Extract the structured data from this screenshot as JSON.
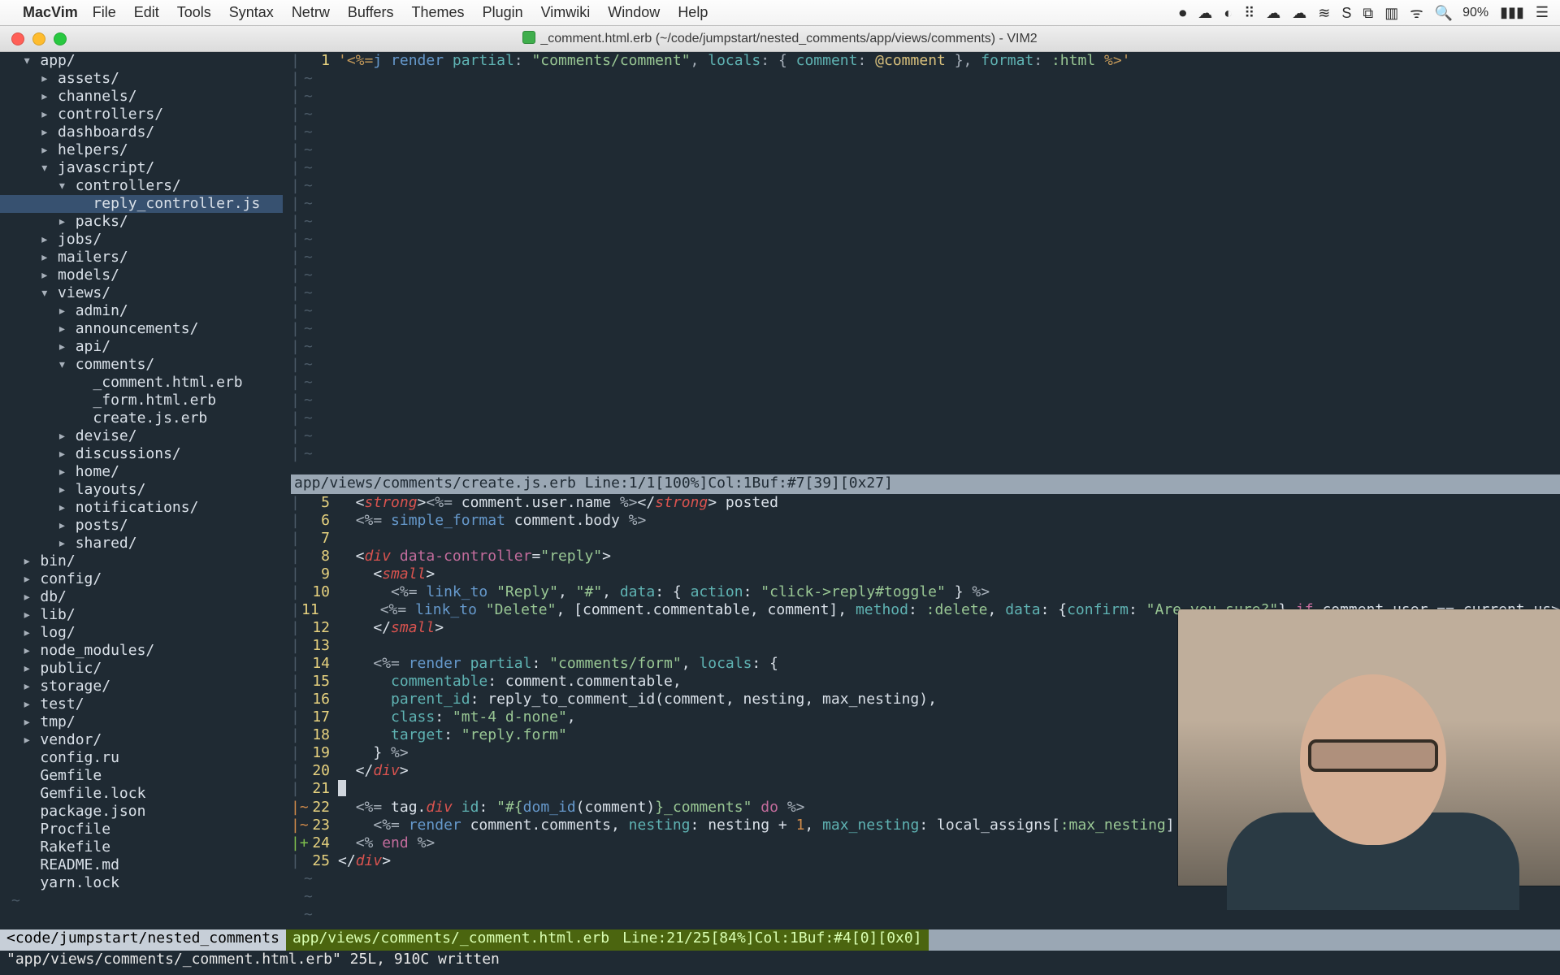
{
  "menubar": {
    "apple": "",
    "app": "MacVim",
    "items": [
      "File",
      "Edit",
      "Tools",
      "Syntax",
      "Netrw",
      "Buffers",
      "Themes",
      "Plugin",
      "Vimwiki",
      "Window",
      "Help"
    ],
    "right_icons": [
      "⏺",
      "☁",
      "◐",
      "⠿",
      "☁",
      "☁",
      "≋",
      "S",
      "⧉",
      "▥",
      "ᯤ",
      "🔍"
    ],
    "percent": "90%",
    "battery": "▮▮▮",
    "hamburger": "☰"
  },
  "titlebar": {
    "title": "_comment.html.erb (~/code/jumpstart/nested_comments/app/views/comments) - VIM2"
  },
  "tree": [
    {
      "i": 0,
      "a": "▾",
      "t": "app/",
      "folder": true
    },
    {
      "i": 1,
      "a": "▸",
      "t": "assets/",
      "folder": true
    },
    {
      "i": 1,
      "a": "▸",
      "t": "channels/",
      "folder": true
    },
    {
      "i": 1,
      "a": "▸",
      "t": "controllers/",
      "folder": true
    },
    {
      "i": 1,
      "a": "▸",
      "t": "dashboards/",
      "folder": true
    },
    {
      "i": 1,
      "a": "▸",
      "t": "helpers/",
      "folder": true
    },
    {
      "i": 1,
      "a": "▾",
      "t": "javascript/",
      "folder": true
    },
    {
      "i": 2,
      "a": "▾",
      "t": "controllers/",
      "folder": true
    },
    {
      "i": 3,
      "a": "",
      "t": "reply_controller.js",
      "folder": false,
      "sel": true
    },
    {
      "i": 2,
      "a": "▸",
      "t": "packs/",
      "folder": true
    },
    {
      "i": 1,
      "a": "▸",
      "t": "jobs/",
      "folder": true
    },
    {
      "i": 1,
      "a": "▸",
      "t": "mailers/",
      "folder": true
    },
    {
      "i": 1,
      "a": "▸",
      "t": "models/",
      "folder": true
    },
    {
      "i": 1,
      "a": "▾",
      "t": "views/",
      "folder": true
    },
    {
      "i": 2,
      "a": "▸",
      "t": "admin/",
      "folder": true
    },
    {
      "i": 2,
      "a": "▸",
      "t": "announcements/",
      "folder": true
    },
    {
      "i": 2,
      "a": "▸",
      "t": "api/",
      "folder": true
    },
    {
      "i": 2,
      "a": "▾",
      "t": "comments/",
      "folder": true
    },
    {
      "i": 3,
      "a": "",
      "t": "_comment.html.erb",
      "folder": false
    },
    {
      "i": 3,
      "a": "",
      "t": "_form.html.erb",
      "folder": false
    },
    {
      "i": 3,
      "a": "",
      "t": "create.js.erb",
      "folder": false
    },
    {
      "i": 2,
      "a": "▸",
      "t": "devise/",
      "folder": true
    },
    {
      "i": 2,
      "a": "▸",
      "t": "discussions/",
      "folder": true
    },
    {
      "i": 2,
      "a": "▸",
      "t": "home/",
      "folder": true
    },
    {
      "i": 2,
      "a": "▸",
      "t": "layouts/",
      "folder": true
    },
    {
      "i": 2,
      "a": "▸",
      "t": "notifications/",
      "folder": true
    },
    {
      "i": 2,
      "a": "▸",
      "t": "posts/",
      "folder": true
    },
    {
      "i": 2,
      "a": "▸",
      "t": "shared/",
      "folder": true
    },
    {
      "i": 0,
      "a": "▸",
      "t": "bin/",
      "folder": true
    },
    {
      "i": 0,
      "a": "▸",
      "t": "config/",
      "folder": true
    },
    {
      "i": 0,
      "a": "▸",
      "t": "db/",
      "folder": true
    },
    {
      "i": 0,
      "a": "▸",
      "t": "lib/",
      "folder": true
    },
    {
      "i": 0,
      "a": "▸",
      "t": "log/",
      "folder": true
    },
    {
      "i": 0,
      "a": "▸",
      "t": "node_modules/",
      "folder": true
    },
    {
      "i": 0,
      "a": "▸",
      "t": "public/",
      "folder": true
    },
    {
      "i": 0,
      "a": "▸",
      "t": "storage/",
      "folder": true
    },
    {
      "i": 0,
      "a": "▸",
      "t": "test/",
      "folder": true
    },
    {
      "i": 0,
      "a": "▸",
      "t": "tmp/",
      "folder": true
    },
    {
      "i": 0,
      "a": "▸",
      "t": "vendor/",
      "folder": true
    },
    {
      "i": 0,
      "a": "",
      "t": "config.ru",
      "folder": false
    },
    {
      "i": 0,
      "a": "",
      "t": "Gemfile",
      "folder": false
    },
    {
      "i": 0,
      "a": "",
      "t": "Gemfile.lock",
      "folder": false
    },
    {
      "i": 0,
      "a": "",
      "t": "package.json",
      "folder": false
    },
    {
      "i": 0,
      "a": "",
      "t": "Procfile",
      "folder": false
    },
    {
      "i": 0,
      "a": "",
      "t": "Rakefile",
      "folder": false
    },
    {
      "i": 0,
      "a": "",
      "t": "README.md",
      "folder": false
    },
    {
      "i": 0,
      "a": "",
      "t": "yarn.lock",
      "folder": false
    }
  ],
  "top_pane": {
    "line_no": "1",
    "code_html": "<span class='c-str'>'&lt;%=</span><span class='c-fn'>j</span> <span class='c-fn'>render</span> <span class='c-id'>partial</span><span class='c-pun'>:</span> <span class='c-sym'>\"comments/comment\"</span><span class='c-pun'>,</span> <span class='c-id'>locals</span><span class='c-pun'>: {</span> <span class='c-id'>comment</span><span class='c-pun'>:</span> <span class='c-var'>@comment</span> <span class='c-pun'>},</span> <span class='c-id'>format</span><span class='c-pun'>:</span> <span class='c-sym'>:html</span> <span class='c-str'>%&gt;'</span>"
  },
  "splitbar": "app/views/comments/create.js.erb   Line:1/1[100%]Col:1Buf:#7[39][0x27]",
  "bottom_pane": {
    "rows": [
      {
        "no": "5",
        "g": " ",
        "html": "  &lt;<span class='c-red'>strong</span>&gt;<span class='c-pun'>&lt;%=</span> comment.user.name <span class='c-pun'>%&gt;</span>&lt;/<span class='c-red'>strong</span>&gt; posted"
      },
      {
        "no": "6",
        "g": " ",
        "html": "  <span class='c-pun'>&lt;%=</span> <span class='c-fn'>simple_format</span> comment.body <span class='c-pun'>%&gt;</span>"
      },
      {
        "no": "7",
        "g": " ",
        "html": ""
      },
      {
        "no": "8",
        "g": " ",
        "html": "  &lt;<span class='c-red'>div</span> <span class='c-attr'>data-controller</span>=<span class='c-sym'>\"reply\"</span>&gt;"
      },
      {
        "no": "9",
        "g": " ",
        "html": "    &lt;<span class='c-red'>small</span>&gt;"
      },
      {
        "no": "10",
        "g": " ",
        "html": "      <span class='c-pun'>&lt;%=</span> <span class='c-fn'>link_to</span> <span class='c-sym'>\"Reply\"</span>, <span class='c-sym'>\"#\"</span>, <span class='c-id'>data</span>: { <span class='c-id'>action</span>: <span class='c-sym'>\"click-&gt;reply#toggle\"</span> } <span class='c-pun'>%&gt;</span>"
      },
      {
        "no": "11",
        "g": " ",
        "html": "      <span class='c-pun'>&lt;%=</span> <span class='c-fn'>link_to</span> <span class='c-sym'>\"Delete\"</span>, [comment.commentable, comment], <span class='c-id'>method</span>: <span class='c-sym'>:delete</span>, <span class='c-id'>data</span>: {<span class='c-id'>confirm</span>: <span class='c-sym'>\"Are you sure?\"</span>} <span class='c-key'>if</span> comment.user == current_us&gt;"
      },
      {
        "no": "12",
        "g": " ",
        "html": "    &lt;/<span class='c-red'>small</span>&gt;"
      },
      {
        "no": "13",
        "g": " ",
        "html": ""
      },
      {
        "no": "14",
        "g": " ",
        "html": "    <span class='c-pun'>&lt;%=</span> <span class='c-fn'>render</span> <span class='c-id'>partial</span>: <span class='c-sym'>\"comments/form\"</span>, <span class='c-id'>locals</span>: {"
      },
      {
        "no": "15",
        "g": " ",
        "html": "      <span class='c-id'>commentable</span>: comment.commentable,"
      },
      {
        "no": "16",
        "g": " ",
        "html": "      <span class='c-id'>parent_id</span>: reply_to_comment_id(comment, nesting, max_nesting),"
      },
      {
        "no": "17",
        "g": " ",
        "html": "      <span class='c-id'>class</span>: <span class='c-sym'>\"mt-4 d-none\"</span>,"
      },
      {
        "no": "18",
        "g": " ",
        "html": "      <span class='c-id'>target</span>: <span class='c-sym'>\"reply.form\"</span>"
      },
      {
        "no": "19",
        "g": " ",
        "html": "    } <span class='c-pun'>%&gt;</span>"
      },
      {
        "no": "20",
        "g": " ",
        "html": "  &lt;/<span class='c-red'>div</span>&gt;"
      },
      {
        "no": "21",
        "g": " ",
        "html": "<span class='cursor'></span>"
      },
      {
        "no": "22",
        "g": "~",
        "html": "  <span class='c-pun'>&lt;%=</span> tag.<span class='c-red'>div</span> <span class='c-id'>id</span>: <span class='c-sym'>\"#{</span><span class='c-fn'>dom_id</span>(comment)<span class='c-sym'>}_comments\"</span> <span class='c-key'>do</span> <span class='c-pun'>%&gt;</span>"
      },
      {
        "no": "23",
        "g": "~",
        "html": "    <span class='c-pun'>&lt;%=</span> <span class='c-fn'>render</span> comment.comments, <span class='c-id'>nesting</span>: nesting + <span class='c-num'>1</span>, <span class='c-id'>max_nesting</span>: local_assigns[<span class='c-sym'>:max_nesting</span>] <span class='c-pun'>%</span>"
      },
      {
        "no": "24",
        "g": "+",
        "html": "  <span class='c-pun'>&lt;%</span> <span class='c-key'>end</span> <span class='c-pun'>%&gt;</span>"
      },
      {
        "no": "25",
        "g": " ",
        "html": "&lt;/<span class='c-red'>div</span>&gt;"
      }
    ]
  },
  "status": {
    "seg1": "<code/jumpstart/nested_comments ",
    "seg2": "app/views/comments/_comment.html.erb ",
    "seg3": " Line:21/25[84%]Col:1Buf:#4[0][0x0]"
  },
  "cmdline": "\"app/views/comments/_comment.html.erb\" 25L, 910C written"
}
